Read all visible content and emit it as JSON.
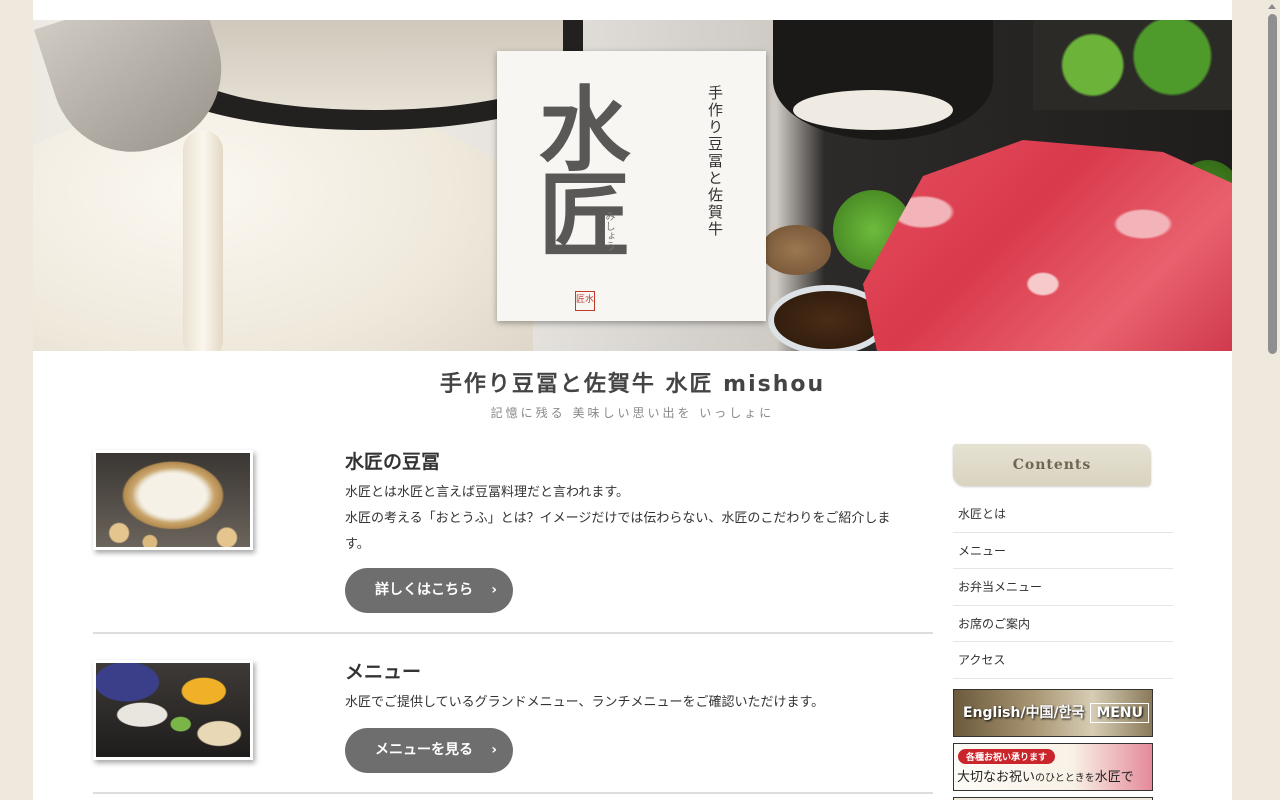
{
  "hero": {
    "logo_main": "水匠",
    "logo_sub": "手作り豆冨と佐賀牛",
    "logo_kana": "みしょう",
    "logo_seal": "匠水"
  },
  "site": {
    "title": "手作り豆冨と佐賀牛 水匠 mishou",
    "tagline": "記憶に残る 美味しい思い出を いっしょに"
  },
  "entries": [
    {
      "title": "水匠の豆冨",
      "lines": [
        "水匠とは水匠と言えば豆冨料理だと言われます。",
        "水匠の考える「おとうふ」とは？イメージだけでは伝わらない、水匠のこだわりをご紹介しま",
        "す。"
      ],
      "button": "詳しくはこちら"
    },
    {
      "title": "メニュー",
      "lines": [
        "水匠でご提供しているグランドメニュー、ランチメニューをご確認いただけます。"
      ],
      "button": "メニューを見る"
    }
  ],
  "sidebar": {
    "heading": "Contents",
    "items": [
      "水匠とは",
      "メニュー",
      "お弁当メニュー",
      "お席のご案内",
      "アクセス"
    ],
    "banner_en": "English/中国/한국",
    "banner_en_menu": "MENU",
    "banner_celebr_tag": "各種お祝い承ります",
    "banner_celebr_big": "大切なお祝い",
    "banner_celebr_small": "のひとときを",
    "banner_celebr_end": "水匠で"
  },
  "icons": {
    "button_arrow": "chevron-right-icon"
  }
}
